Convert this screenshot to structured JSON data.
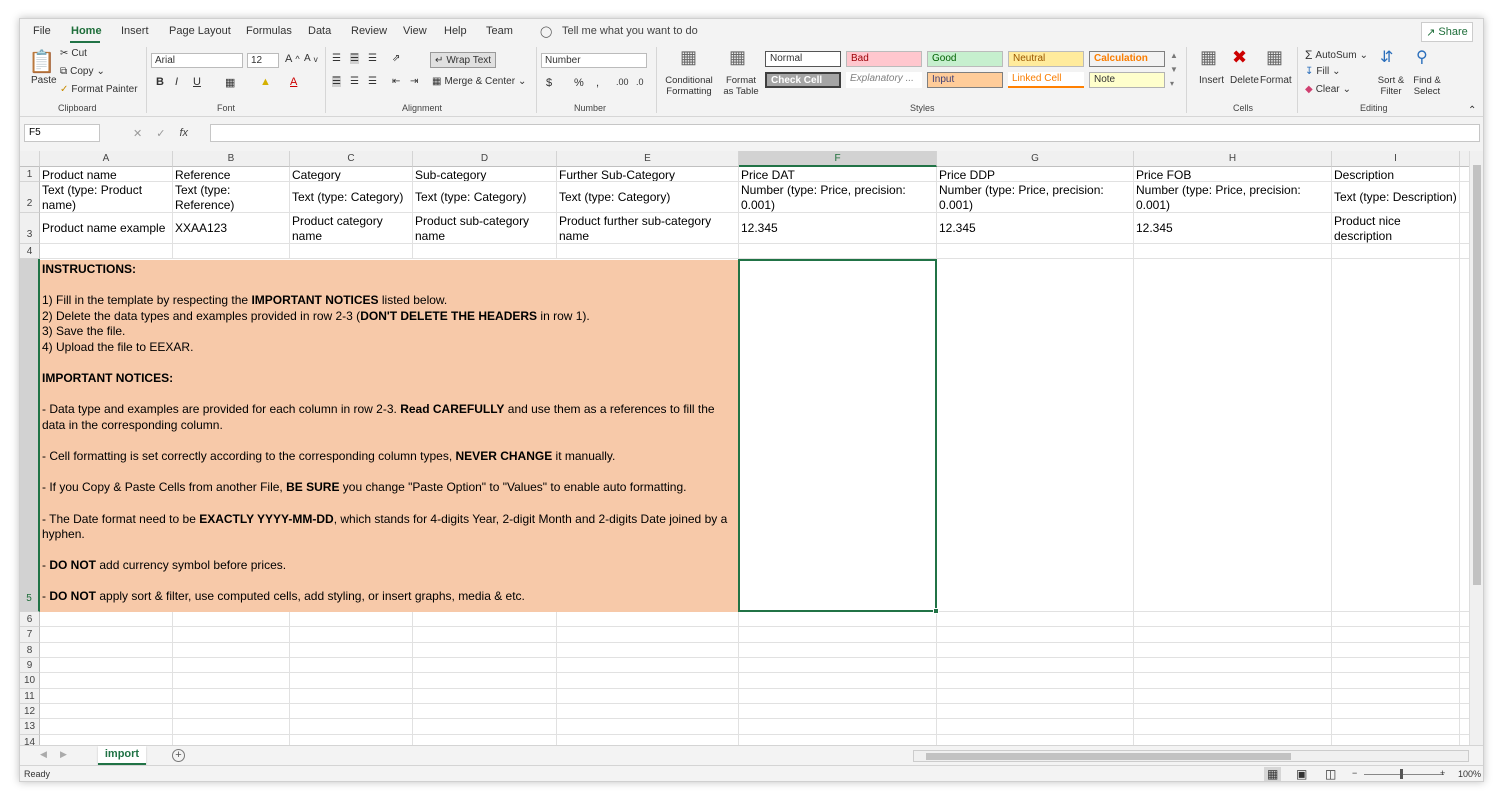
{
  "tabs": [
    "File",
    "Home",
    "Insert",
    "Page Layout",
    "Formulas",
    "Data",
    "Review",
    "View",
    "Help",
    "Team"
  ],
  "tell_me": "Tell me what you want to do",
  "share": "Share",
  "ribbon": {
    "paste": "Paste",
    "cut": "Cut",
    "copy": "Copy",
    "format_painter": "Format Painter",
    "clipboard_label": "Clipboard",
    "font_name": "Arial",
    "font_size": "12",
    "font_label": "Font",
    "wrap_text": "Wrap Text",
    "merge_center": "Merge & Center",
    "alignment_label": "Alignment",
    "number_format": "Number",
    "number_label": "Number",
    "conditional_formatting": "Conditional Formatting",
    "format_as_table": "Format as Table",
    "styles": {
      "normal": "Normal",
      "bad": "Bad",
      "good": "Good",
      "neutral": "Neutral",
      "calculation": "Calculation",
      "check_cell": "Check Cell",
      "explanatory": "Explanatory ...",
      "input": "Input",
      "linked_cell": "Linked Cell",
      "note": "Note"
    },
    "styles_label": "Styles",
    "insert": "Insert",
    "delete": "Delete",
    "format": "Format",
    "cells_label": "Cells",
    "autosum": "AutoSum",
    "fill": "Fill",
    "clear": "Clear",
    "sort_filter": "Sort & Filter",
    "find_select": "Find & Select",
    "editing_label": "Editing"
  },
  "formula_bar": {
    "name_box": "F5",
    "fx": "fx",
    "value": ""
  },
  "columns": [
    "A",
    "B",
    "C",
    "D",
    "E",
    "F",
    "G",
    "H",
    "I"
  ],
  "rows": {
    "r1": [
      "Product name",
      "Reference",
      "Category",
      "Sub-category",
      "Further Sub-Category",
      "Price DAT",
      "Price DDP",
      "Price FOB",
      "Description"
    ],
    "r2": [
      "Text (type: Product name)",
      "Text (type: Reference)",
      "Text (type: Category)",
      "Text (type: Category)",
      "Text (type: Category)",
      "Number (type: Price, precision: 0.001)",
      "Number (type: Price, precision: 0.001)",
      "Number (type: Price, precision: 0.001)",
      "Text (type: Description)"
    ],
    "r3": [
      "Product name example",
      "XXAA123",
      "Product category name",
      "Product sub-category name",
      "Product further sub-category name",
      "12.345",
      "12.345",
      "12.345",
      "Product nice description"
    ]
  },
  "instructions": {
    "heading": "INSTRUCTIONS:",
    "step1_a": "1) Fill in the template by respecting the ",
    "step1_b": "IMPORTANT NOTICES",
    "step1_c": " listed below.",
    "step2_a": "2) Delete the data types and examples provided in row 2-3 (",
    "step2_b": "DON'T DELETE THE HEADERS",
    "step2_c": " in row 1).",
    "step3": "3) Save the file.",
    "step4": "4) Upload the file to EEXAR.",
    "notices_heading": "IMPORTANT NOTICES:",
    "n1_a": "- Data type and examples are provided for each column in row 2-3. ",
    "n1_b": "Read CAREFULLY",
    "n1_c": " and use them as a references to fill the data in the corresponding column.",
    "n2_a": "- Cell formatting is set correctly according to the corresponding column types, ",
    "n2_b": "NEVER CHANGE",
    "n2_c": " it manually.",
    "n3_a": "- If you Copy & Paste Cells from another File, ",
    "n3_b": "BE SURE",
    "n3_c": " you change \"Paste Option\" to \"Values\" to enable auto formatting.",
    "n4_a": "- The Date format need to be ",
    "n4_b": "EXACTLY YYYY-MM-DD",
    "n4_c": ", which stands for 4-digits Year, 2-digit Month and 2-digits Date joined by a hyphen.",
    "n5_a": "- ",
    "n5_b": "DO NOT",
    "n5_c": " add currency symbol before prices.",
    "n6_a": "- ",
    "n6_b": "DO NOT",
    "n6_c": " apply sort & filter, use computed cells, add styling, or insert graphs, media & etc."
  },
  "row_numbers": [
    "1",
    "2",
    "3",
    "4",
    "5",
    "6",
    "7",
    "8",
    "9",
    "10",
    "11",
    "12",
    "13",
    "14"
  ],
  "sheet_tab": "import",
  "status": "Ready",
  "zoom": "100%"
}
